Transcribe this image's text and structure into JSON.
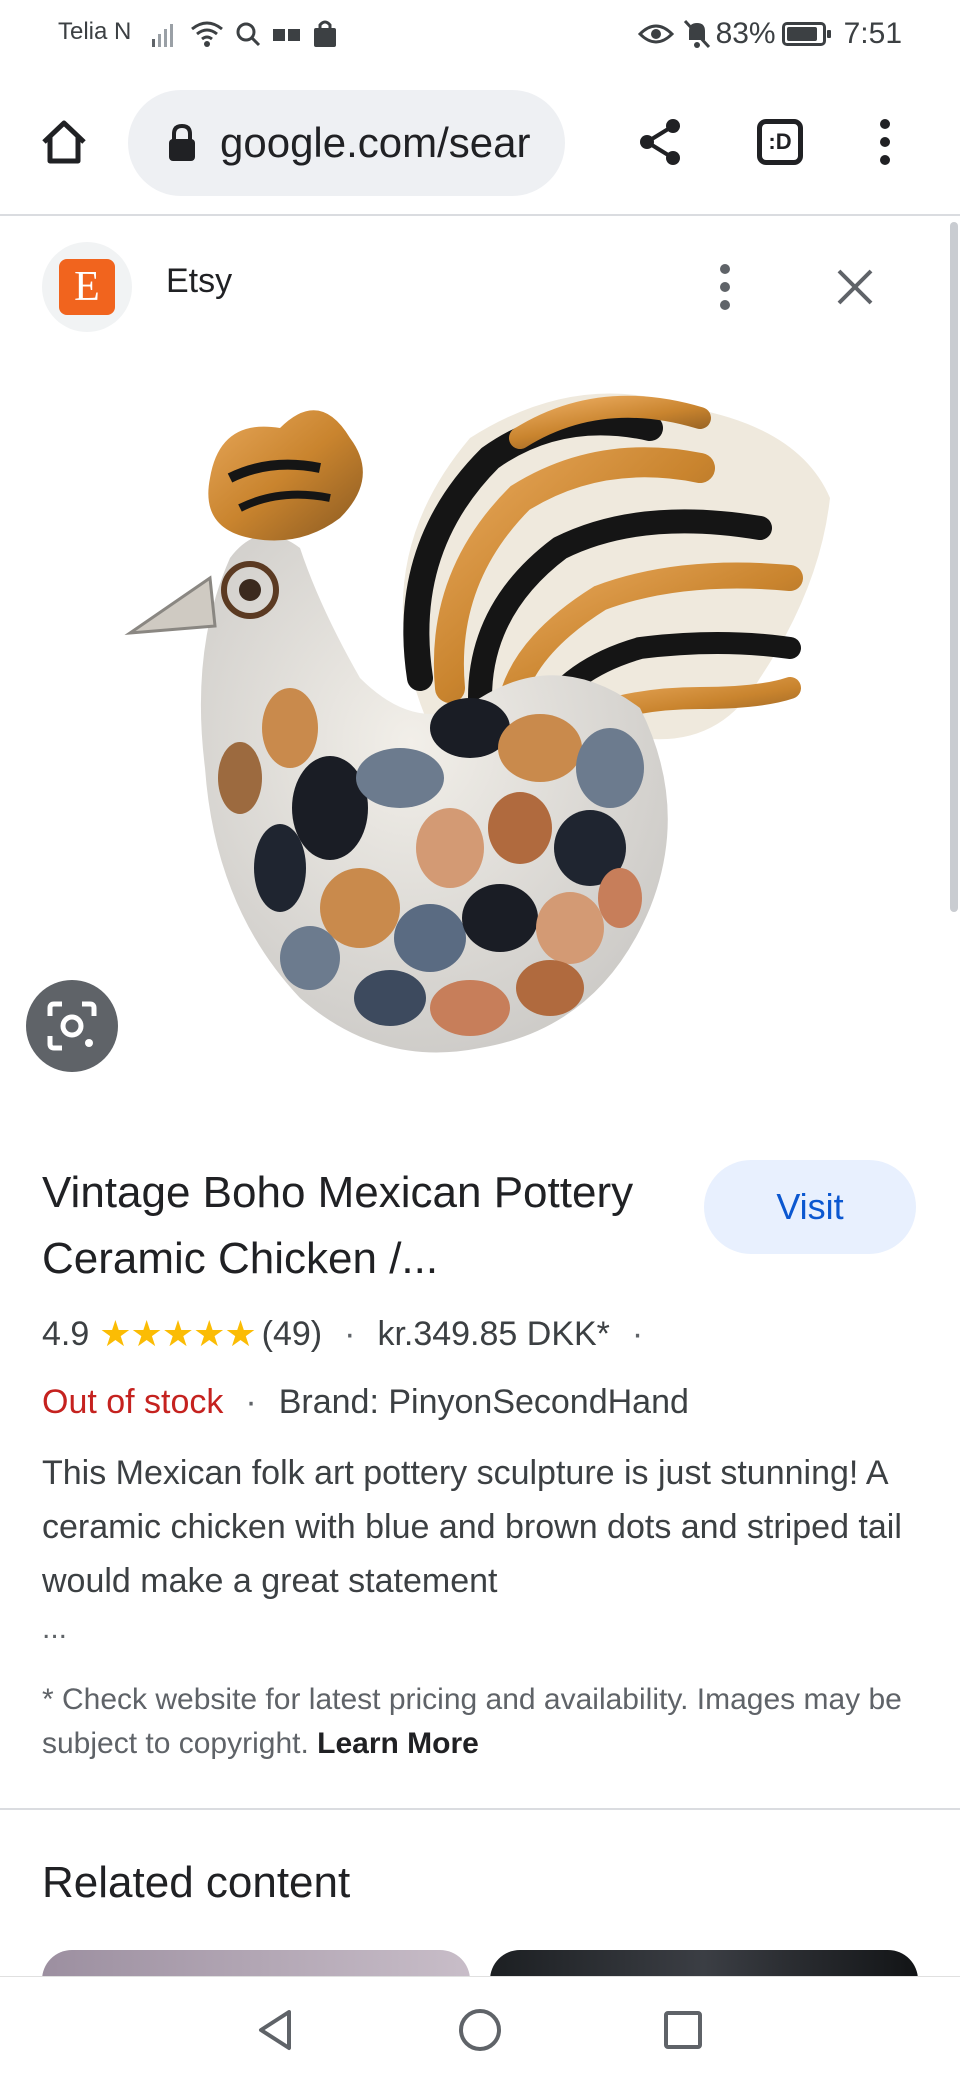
{
  "status_bar": {
    "carrier": "Telia N",
    "battery": "83%",
    "time": "7:51"
  },
  "browser": {
    "url": "google.com/sear",
    "tabs_label": ":D"
  },
  "source": {
    "logo_letter": "E",
    "name": "Etsy"
  },
  "product": {
    "title": "Vintage Boho Mexican Pottery Ceramic Chicken /...",
    "visit_label": "Visit",
    "rating": "4.9",
    "stars": "★★★★★",
    "review_count": "(49)",
    "separator": "·",
    "price": "kr.349.85 DKK*",
    "stock_status": "Out of stock",
    "brand": "Brand: PinyonSecondHand",
    "description": "This Mexican folk art pottery sculpture is just stunning! A ceramic chicken with blue and brown dots and striped tail would make a great statement",
    "ellipsis": "...",
    "disclaimer": "* Check website for latest pricing and availability. Images may be subject to copyright.",
    "learn_more": "Learn More"
  },
  "related": {
    "title": "Related content"
  },
  "colors": {
    "etsy_orange": "#f1641e",
    "visit_bg": "#e8f0fe",
    "visit_text": "#0b57d0",
    "out_of_stock": "#c5221f",
    "star": "#fbbc04"
  },
  "icons": [
    "home-icon",
    "lock-icon",
    "share-icon",
    "more-vert-icon",
    "close-icon",
    "lens-icon",
    "back-icon",
    "home-circle-icon",
    "recents-icon"
  ]
}
